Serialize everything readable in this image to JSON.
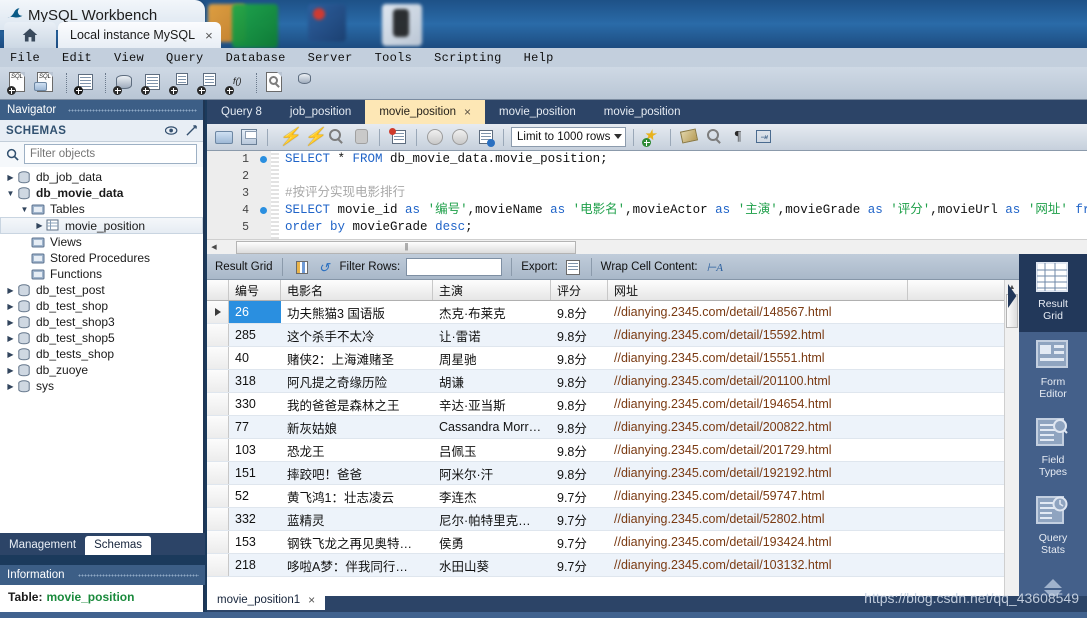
{
  "window": {
    "title": "MySQL Workbench",
    "home_icon": "home-icon",
    "connection_tab": "Local instance MySQL",
    "close_glyph": "×"
  },
  "menubar": {
    "items": [
      "File",
      "Edit",
      "View",
      "Query",
      "Database",
      "Server",
      "Tools",
      "Scripting",
      "Help"
    ]
  },
  "main_toolbar": {
    "icons": [
      "new-sql-file-icon",
      "open-sql-file-icon",
      "connection-info-icon",
      "new-schema-icon",
      "new-table-icon",
      "new-view-icon",
      "new-procedure-icon",
      "new-function-icon",
      "inspect-table-icon",
      "reconnect-server-icon"
    ]
  },
  "navigator": {
    "title": "Navigator",
    "section": "SCHEMAS",
    "actions": [
      "toggle-schema-contents-icon",
      "collapse-all-icon"
    ],
    "filter_placeholder": "Filter objects",
    "filter_value": "",
    "tree": [
      {
        "label": "db_job_data",
        "indent": 0,
        "arrow": "▶",
        "icon": "database-icon",
        "bold": false,
        "selected": false
      },
      {
        "label": "db_movie_data",
        "indent": 0,
        "arrow": "▼",
        "icon": "database-icon",
        "bold": true,
        "selected": false
      },
      {
        "label": "Tables",
        "indent": 1,
        "arrow": "▼",
        "icon": "folder-icon",
        "bold": false,
        "selected": false
      },
      {
        "label": "movie_position",
        "indent": 2,
        "arrow": "▶",
        "icon": "table-icon",
        "bold": false,
        "selected": true
      },
      {
        "label": "Views",
        "indent": 1,
        "arrow": "",
        "icon": "folder-icon",
        "bold": false,
        "selected": false
      },
      {
        "label": "Stored Procedures",
        "indent": 1,
        "arrow": "",
        "icon": "folder-icon",
        "bold": false,
        "selected": false
      },
      {
        "label": "Functions",
        "indent": 1,
        "arrow": "",
        "icon": "folder-icon",
        "bold": false,
        "selected": false
      },
      {
        "label": "db_test_post",
        "indent": 0,
        "arrow": "▶",
        "icon": "database-icon",
        "bold": false,
        "selected": false
      },
      {
        "label": "db_test_shop",
        "indent": 0,
        "arrow": "▶",
        "icon": "database-icon",
        "bold": false,
        "selected": false
      },
      {
        "label": "db_test_shop3",
        "indent": 0,
        "arrow": "▶",
        "icon": "database-icon",
        "bold": false,
        "selected": false
      },
      {
        "label": "db_test_shop5",
        "indent": 0,
        "arrow": "▶",
        "icon": "database-icon",
        "bold": false,
        "selected": false
      },
      {
        "label": "db_tests_shop",
        "indent": 0,
        "arrow": "▶",
        "icon": "database-icon",
        "bold": false,
        "selected": false
      },
      {
        "label": "db_zuoye",
        "indent": 0,
        "arrow": "▶",
        "icon": "database-icon",
        "bold": false,
        "selected": false
      },
      {
        "label": "sys",
        "indent": 0,
        "arrow": "▶",
        "icon": "database-icon",
        "bold": false,
        "selected": false
      }
    ],
    "bottom_tabs": [
      {
        "label": "Management",
        "active": false
      },
      {
        "label": "Schemas",
        "active": true
      }
    ]
  },
  "information": {
    "title": "Information",
    "key": "Table:",
    "value": "movie_position"
  },
  "editor_tabs": [
    {
      "label": "Query 8",
      "active": false,
      "closable": false
    },
    {
      "label": "job_position",
      "active": false,
      "closable": false
    },
    {
      "label": "movie_position",
      "active": true,
      "closable": true
    },
    {
      "label": "movie_position",
      "active": false,
      "closable": false
    },
    {
      "label": "movie_position",
      "active": false,
      "closable": false
    }
  ],
  "sql_toolbar": {
    "icons": [
      "open-script-icon",
      "save-script-icon",
      "execute-statement-icon",
      "execute-current-statement-icon",
      "explain-statement-icon",
      "stop-script-icon",
      "toggle-stop-on-error-icon",
      "commit-icon",
      "rollback-icon",
      "autocommit-icon"
    ],
    "limit_label": "Limit to 1000 rows",
    "trailing_icons": [
      "new-snippet-icon",
      "beautify-sql-icon",
      "find-icon",
      "show-invisible-chars-icon",
      "wrap-lines-icon"
    ]
  },
  "sql_editor": {
    "line_numbers": [
      "1",
      "2",
      "3",
      "4",
      "5"
    ],
    "breakpoints": [
      true,
      false,
      false,
      true,
      false
    ],
    "lines": [
      [
        {
          "t": "SELECT",
          "c": "kw"
        },
        {
          "t": " * ",
          "c": "op"
        },
        {
          "t": "FROM",
          "c": "kw"
        },
        {
          "t": " db_movie_data.movie_position;",
          "c": "pl"
        }
      ],
      [],
      [
        {
          "t": "#按评分实现电影排行",
          "c": "cmt"
        }
      ],
      [
        {
          "t": "SELECT",
          "c": "kw"
        },
        {
          "t": " movie_id ",
          "c": "pl"
        },
        {
          "t": "as",
          "c": "kw"
        },
        {
          "t": " ",
          "c": "pl"
        },
        {
          "t": "'编号'",
          "c": "str"
        },
        {
          "t": ",movieName ",
          "c": "pl"
        },
        {
          "t": "as",
          "c": "kw"
        },
        {
          "t": " ",
          "c": "pl"
        },
        {
          "t": "'电影名'",
          "c": "str"
        },
        {
          "t": ",movieActor ",
          "c": "pl"
        },
        {
          "t": "as",
          "c": "kw"
        },
        {
          "t": " ",
          "c": "pl"
        },
        {
          "t": "'主演'",
          "c": "str"
        },
        {
          "t": ",movieGrade ",
          "c": "pl"
        },
        {
          "t": "as",
          "c": "kw"
        },
        {
          "t": " ",
          "c": "pl"
        },
        {
          "t": "'评分'",
          "c": "str"
        },
        {
          "t": ",movieUrl ",
          "c": "pl"
        },
        {
          "t": "as",
          "c": "kw"
        },
        {
          "t": " ",
          "c": "pl"
        },
        {
          "t": "'网址'",
          "c": "str"
        },
        {
          "t": " ",
          "c": "pl"
        },
        {
          "t": "from",
          "c": "kw"
        }
      ],
      [
        {
          "t": "order",
          "c": "kw"
        },
        {
          "t": " ",
          "c": "pl"
        },
        {
          "t": "by",
          "c": "kw"
        },
        {
          "t": " movieGrade ",
          "c": "pl"
        },
        {
          "t": "desc",
          "c": "kw"
        },
        {
          "t": ";",
          "c": "pl"
        }
      ]
    ]
  },
  "result_toolbar": {
    "result_grid_label": "Result Grid",
    "icons": [
      "grid-toggle-icon",
      "refresh-icon"
    ],
    "filter_rows_label": "Filter Rows:",
    "filter_rows_value": "",
    "export_label": "Export:",
    "export_icon": "export-recordset-icon",
    "wrap_label": "Wrap Cell Content:",
    "wrap_icon": "wrap-cell-icon",
    "panel_toggle_icon": "toggle-sidebar-icon"
  },
  "result_grid": {
    "columns": [
      "编号",
      "电影名",
      "主演",
      "评分",
      "网址"
    ],
    "rows": [
      {
        "selected": true,
        "cells": [
          "26",
          "功夫熊猫3 国语版",
          "杰克·布莱克",
          "9.8分",
          "//dianying.2345.com/detail/148567.html"
        ]
      },
      {
        "selected": false,
        "cells": [
          "285",
          "这个杀手不太冷",
          "让·雷诺",
          "9.8分",
          "//dianying.2345.com/detail/15592.html"
        ]
      },
      {
        "selected": false,
        "cells": [
          "40",
          "赌侠2：上海滩赌圣",
          "周星驰",
          "9.8分",
          "//dianying.2345.com/detail/15551.html"
        ]
      },
      {
        "selected": false,
        "cells": [
          "318",
          "阿凡提之奇缘历险",
          "胡谦",
          "9.8分",
          "//dianying.2345.com/detail/201100.html"
        ]
      },
      {
        "selected": false,
        "cells": [
          "330",
          "我的爸爸是森林之王",
          "辛达·亚当斯",
          "9.8分",
          "//dianying.2345.com/detail/194654.html"
        ]
      },
      {
        "selected": false,
        "cells": [
          "77",
          "新灰姑娘",
          "Cassandra Morr…",
          "9.8分",
          "//dianying.2345.com/detail/200822.html"
        ]
      },
      {
        "selected": false,
        "cells": [
          "103",
          "恐龙王",
          "吕佩玉",
          "9.8分",
          "//dianying.2345.com/detail/201729.html"
        ]
      },
      {
        "selected": false,
        "cells": [
          "151",
          "摔跤吧！爸爸",
          "阿米尔·汗",
          "9.8分",
          "//dianying.2345.com/detail/192192.html"
        ]
      },
      {
        "selected": false,
        "cells": [
          "52",
          "黄飞鸿1：壮志凌云",
          "李连杰",
          "9.7分",
          "//dianying.2345.com/detail/59747.html"
        ]
      },
      {
        "selected": false,
        "cells": [
          "332",
          "蓝精灵",
          "尼尔·帕特里克…",
          "9.7分",
          "//dianying.2345.com/detail/52802.html"
        ]
      },
      {
        "selected": false,
        "cells": [
          "153",
          "钢铁飞龙之再见奥特…",
          "侯勇",
          "9.7分",
          "//dianying.2345.com/detail/193424.html"
        ]
      },
      {
        "selected": false,
        "cells": [
          "218",
          "哆啦A梦：伴我同行…",
          "水田山葵",
          "9.7分",
          "//dianying.2345.com/detail/103132.html"
        ]
      }
    ]
  },
  "side_panel": {
    "items": [
      {
        "label": "Result\nGrid",
        "label_line1": "Result",
        "label_line2": "Grid",
        "icon": "result-grid-icon",
        "active": true
      },
      {
        "label": "Form\nEditor",
        "label_line1": "Form",
        "label_line2": "Editor",
        "icon": "form-editor-icon",
        "active": false
      },
      {
        "label": "Field\nTypes",
        "label_line1": "Field",
        "label_line2": "Types",
        "icon": "field-types-icon",
        "active": false
      },
      {
        "label": "Query\nStats",
        "label_line1": "Query",
        "label_line2": "Stats",
        "icon": "query-stats-icon",
        "active": false
      }
    ],
    "scroll_icons": [
      "chevron-up-icon",
      "chevron-down-icon"
    ]
  },
  "bottom": {
    "tab_label": "movie_position1",
    "tab_close": "×",
    "watermark": "https://blog.csdn.net/qq_43608549"
  },
  "colors": {
    "accent_blue": "#2a8fe0",
    "panel_header": "#3c5e86",
    "dark_chrome": "#2c4467",
    "active_tab": "#fde7b5",
    "keyword": "#2064c8",
    "string": "#1fa04a",
    "comment": "#a8a8a8",
    "url_text": "#7a3a12"
  }
}
